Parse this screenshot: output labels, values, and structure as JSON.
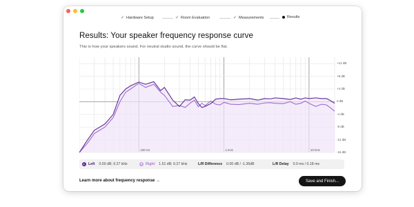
{
  "steps": [
    {
      "label": "Hardware Setup",
      "state": "done"
    },
    {
      "label": "Room Evaluation",
      "state": "done"
    },
    {
      "label": "Measurements",
      "state": "done"
    },
    {
      "label": "Results",
      "state": "current"
    }
  ],
  "step_icons": {
    "done": "checkmark-icon",
    "current": "dot-icon"
  },
  "title": "Results: Your speaker frequency response curve",
  "subtitle": "This is how your speakers sound. For neutral studio sound, the curve should be flat.",
  "chart_data": {
    "type": "line",
    "xscale": "log",
    "xlim": [
      20,
      20000
    ],
    "ylim": [
      -16,
      14
    ],
    "x_ticks": [
      {
        "value": 100,
        "label": "100 Hz"
      },
      {
        "value": 1000,
        "label": "1 kHz"
      },
      {
        "value": 10000,
        "label": "10 kHz"
      }
    ],
    "y_ticks": [
      {
        "value": 12,
        "label": "+12 dB"
      },
      {
        "value": 8,
        "label": "+8 dB"
      },
      {
        "value": 4,
        "label": "+4 dB"
      },
      {
        "value": 0,
        "label": "0 dB"
      },
      {
        "value": -4,
        "label": "-4 dB"
      },
      {
        "value": -8,
        "label": "-8 dB"
      },
      {
        "value": -12,
        "label": "-12 dB"
      },
      {
        "value": -16,
        "label": "-16 dB"
      }
    ],
    "grid": true,
    "series": [
      {
        "name": "Left",
        "color": "#5c2a91",
        "fill": "#efe4f8",
        "x": [
          20,
          25,
          30,
          40,
          50,
          60,
          70,
          80,
          100,
          120,
          150,
          180,
          200,
          250,
          300,
          350,
          400,
          450,
          500,
          550,
          600,
          700,
          800,
          900,
          1000,
          1200,
          1500,
          2000,
          2500,
          3000,
          3500,
          4000,
          5000,
          6000,
          7000,
          8000,
          9000,
          10000,
          12000,
          14000,
          16000,
          18000,
          20000
        ],
        "y": [
          -16,
          -12,
          -9,
          -7,
          -4,
          2,
          4,
          5,
          6.2,
          5.5,
          6.3,
          3.5,
          4.5,
          0.5,
          -1.5,
          0.6,
          0.5,
          1.5,
          -0.6,
          -1.8,
          -1.5,
          -0.6,
          0.8,
          1.0,
          1.0,
          0.6,
          0.8,
          1.0,
          0.5,
          1.0,
          0.9,
          1.2,
          1.0,
          0.7,
          1.2,
          0.8,
          1.2,
          1.0,
          1.2,
          1.0,
          1.0,
          0.3,
          -0.5
        ]
      },
      {
        "name": "Right",
        "color": "#a06ad1",
        "x": [
          20,
          25,
          30,
          40,
          50,
          60,
          70,
          80,
          100,
          120,
          150,
          180,
          200,
          250,
          300,
          350,
          400,
          450,
          500,
          550,
          600,
          700,
          800,
          900,
          1000,
          1200,
          1500,
          2000,
          2500,
          3000,
          3500,
          4000,
          5000,
          6000,
          7000,
          8000,
          9000,
          10000,
          12000,
          14000,
          16000,
          18000,
          20000
        ],
        "y": [
          -16,
          -13,
          -10,
          -8,
          -5,
          0,
          3,
          4,
          5.8,
          4.5,
          5.5,
          3.0,
          2.0,
          -1.5,
          -1.2,
          -1.8,
          -0.5,
          0.5,
          -1.6,
          -0.5,
          -1.2,
          0.2,
          -0.8,
          -1.0,
          -0.2,
          -0.8,
          -0.9,
          -0.5,
          -0.8,
          -0.4,
          -0.3,
          -0.5,
          -0.6,
          0.0,
          -0.8,
          -0.5,
          0.2,
          -0.5,
          -1.5,
          -0.8,
          -1.0,
          -2.0,
          -3.0
        ]
      }
    ]
  },
  "legend": {
    "left": {
      "badge": "L",
      "name": "Left",
      "value": "0.50 dB; 9.27 kHz"
    },
    "right": {
      "badge": "R",
      "name": "Right",
      "value": "1.51 dB; 9.27 kHz"
    },
    "lr_difference": {
      "label": "L/R Difference",
      "value": "0.00 dB / -1.36dB"
    },
    "lr_delay": {
      "label": "L/R Delay",
      "value": "0.0 ms / 0.18 ms"
    }
  },
  "learn_more": "Learn more about frequency response →",
  "save_button": "Save and Finish..."
}
